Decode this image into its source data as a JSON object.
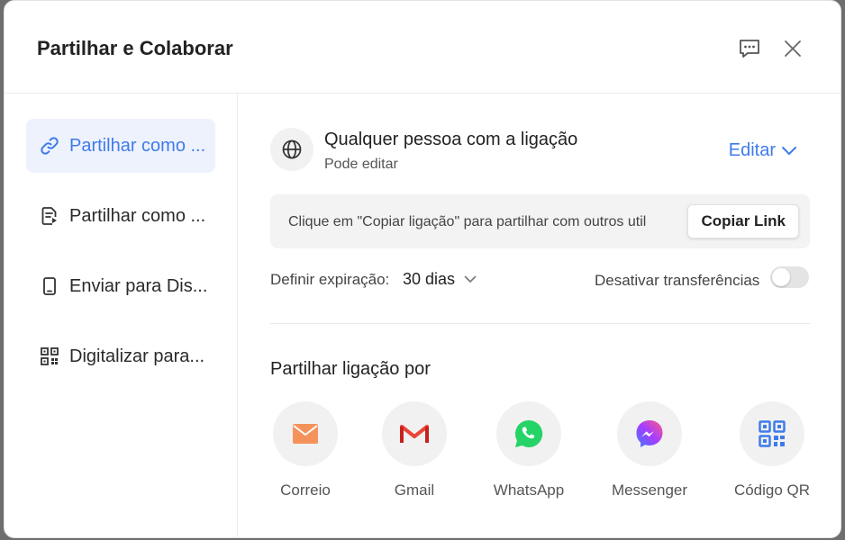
{
  "dialog": {
    "title": "Partilhar e Colaborar",
    "header_icons": [
      "feedback-icon",
      "close-icon"
    ]
  },
  "sidebar": {
    "items": [
      {
        "label": "Partilhar como ...",
        "icon": "link-icon",
        "active": true
      },
      {
        "label": "Partilhar como ...",
        "icon": "file-share-icon",
        "active": false
      },
      {
        "label": "Enviar para Dis...",
        "icon": "phone-icon",
        "active": false
      },
      {
        "label": "Digitalizar para...",
        "icon": "qr-code-icon",
        "active": false
      }
    ]
  },
  "access": {
    "title": "Qualquer pessoa com a ligação",
    "subtitle": "Pode editar",
    "edit_label": "Editar"
  },
  "link": {
    "text": "Clique em \"Copiar ligação\" para partilhar com outros util",
    "copy_label": "Copiar Link"
  },
  "expiration": {
    "label": "Definir expiração:",
    "value": "30 dias"
  },
  "downloads": {
    "label": "Desativar transferências",
    "enabled": false
  },
  "share": {
    "title": "Partilhar ligação por",
    "options": [
      {
        "label": "Correio",
        "icon": "mail-icon"
      },
      {
        "label": "Gmail",
        "icon": "gmail-icon"
      },
      {
        "label": "WhatsApp",
        "icon": "whatsapp-icon"
      },
      {
        "label": "Messenger",
        "icon": "messenger-icon"
      },
      {
        "label": "Código QR",
        "icon": "qr-code-icon"
      }
    ]
  },
  "colors": {
    "accent": "#3f7bea",
    "active_bg": "#eef2fd",
    "mail": "#f5925b",
    "gmail": "#ea4335",
    "whatsapp": "#25d366",
    "messenger": "#8b5cf6",
    "qr": "#3f7bea"
  }
}
